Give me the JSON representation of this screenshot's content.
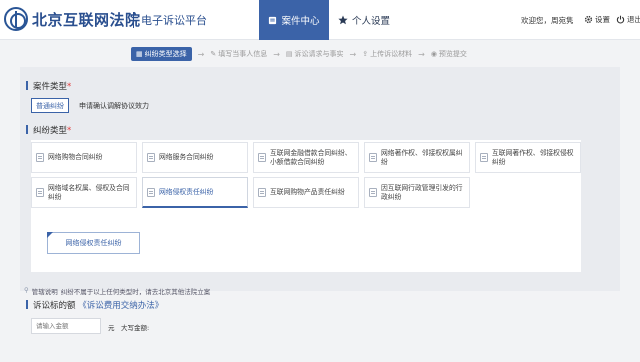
{
  "header": {
    "court_name": "北京互联网法院",
    "platform_name": "电子诉讼平台",
    "nav": [
      {
        "label": "案件中心",
        "icon": "document-icon"
      },
      {
        "label": "个人设置",
        "icon": "star-icon"
      }
    ],
    "welcome": "欢迎您，周宛隽",
    "settings_label": "设置",
    "logout_label": "退出"
  },
  "steps": [
    {
      "label": "纠纷类型选择",
      "icon": "grid-icon"
    },
    {
      "label": "填写当事人信息",
      "icon": "pencil-icon"
    },
    {
      "label": "诉讼请求与事实",
      "icon": "note-icon"
    },
    {
      "label": "上传诉讼材料",
      "icon": "upload-icon"
    },
    {
      "label": "预览提交",
      "icon": "eye-icon"
    }
  ],
  "case_type": {
    "title": "案件类型",
    "required_mark": "*",
    "tabs": [
      "普通纠纷",
      "申请确认调解协议效力"
    ]
  },
  "dispute_type": {
    "title": "纠纷类型",
    "required_mark": "*",
    "cards": [
      {
        "label": "网络购物合同纠纷"
      },
      {
        "label": "网络服务合同纠纷"
      },
      {
        "label": "互联网金融借款合同纠纷、小额借款合同纠纷"
      },
      {
        "label": "网络著作权、邻接权权属纠纷"
      },
      {
        "label": "互联网著作权、邻接权侵权纠纷"
      },
      {
        "label": "网络域名权属、侵权及合同纠纷"
      },
      {
        "label": "网络侵权责任纠纷"
      },
      {
        "label": "互联网购物产品责任纠纷"
      },
      {
        "label": "因互联网行政管理引发的行政纠纷"
      }
    ],
    "selected_index": 6,
    "sub_selected": "网络侵权责任纠纷"
  },
  "note": {
    "prefix": "管辖说明",
    "text": "纠纷不属于以上任何类型时，请去北京其他法院立案"
  },
  "amount": {
    "title": "诉讼标的额",
    "link": "《诉讼费用交纳办法》",
    "placeholder": "请输入金额",
    "unit": "元",
    "daxie_label": "大写金额:"
  }
}
